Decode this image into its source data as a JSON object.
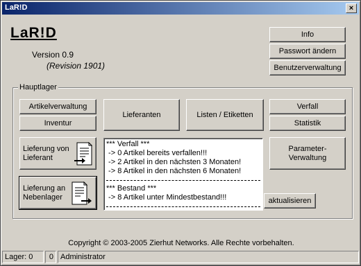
{
  "window": {
    "title": "LaR!D"
  },
  "app": {
    "logo": "LaR!D",
    "version": "Version 0.9",
    "revision": "(Revision 1901)"
  },
  "top_buttons": {
    "info": "Info",
    "password": "Passwort ändern",
    "users": "Benutzerverwaltung"
  },
  "group": {
    "label": "Hauptlager",
    "buttons": {
      "articles": "Artikelverwaltung",
      "inventory": "Inventur",
      "suppliers": "Lieferanten",
      "lists": "Listen / Etiketten",
      "expiry": "Verfall",
      "statistics": "Statistik",
      "delivery_from_supplier": "Lieferung von\nLieferant",
      "delivery_to_sublocation": "Lieferung an\nNebenlager",
      "parameters": "Parameter-\nVerwaltung",
      "refresh": "aktualisieren"
    }
  },
  "info_box": {
    "expiry_header": "*** Verfall ***",
    "expiry_lines": [
      " -> 0 Artikel bereits verfallen!!!",
      " -> 2 Artikel in den nächsten 3 Monaten!",
      " -> 8 Artikel in den nächsten 6 Monaten!"
    ],
    "stock_header": "*** Bestand ***",
    "stock_lines": [
      " -> 8 Artikel unter Mindestbestand!!!"
    ]
  },
  "copyright": "Copyright © 2003-2005 Zierhut Networks. Alle Rechte vorbehalten.",
  "status": {
    "lager": "Lager: 0",
    "count": "0",
    "user": "Administrator"
  }
}
